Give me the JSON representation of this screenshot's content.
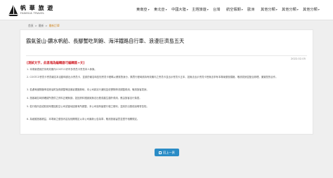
{
  "header": {
    "logo_zh": "帆 華 旅 遊",
    "logo_en": "FANHUA TRAVEL",
    "nav": [
      {
        "label": "東南亞",
        "dropdown": true
      },
      {
        "label": "東北亞",
        "dropdown": true
      },
      {
        "label": "中國大陸",
        "dropdown": true
      },
      {
        "label": "主題旅遊",
        "dropdown": true
      },
      {
        "label": "台灣",
        "dropdown": false
      },
      {
        "label": "航空假期",
        "dropdown": true
      },
      {
        "label": "歐洲",
        "dropdown": false
      },
      {
        "label": "其他分類",
        "dropdown": true
      },
      {
        "label": "其他分類",
        "dropdown": true
      },
      {
        "label": "其他分類",
        "dropdown": true
      }
    ]
  },
  "breadcrumb": {
    "home": "首頁",
    "section": "最新",
    "current": "最新訂單"
  },
  "article": {
    "title": "霸氣釜山-鑽水帆船、長腳蟹吃到飽、海洋鐵路自行車、浪漫巨濟島五天",
    "date": "2022.02.05",
    "notice": "[測試文字，此區塊為編輯器可編輯區+文]",
    "paragraphs": [
      "1. 本專案適用於持有效期內COSTCO好市多會員卡會員本人參與。",
      "2. COSTCO會員卡會員報名本活動時請出示會員卡，並請於報名時告知會員卡號碼以便核對身分，購買行程時請持有效期內之會員卡並出示會員卡正本，如無法出示會員卡恕無法享有本專案優惠價格，敬請見諒並配合辦理，謝謝您的合作。",
      "3. 若遇有國際匯率或燃油附加費調整等因素影響團費時，本公司將另行通知並依實際情況調整費用，敬請旅客見諒。",
      "4. 旅客報名時請確認所提供之資料正確無誤，如因資料錯誤致無法出發或產生額外費用，應由旅客自行負擔。",
      "5. 若行程內容或航班時間因航空公司或當地因素有所調整，本公司保有變更行程之權利，並將於出發前說明會告知。",
      "6. 為維護旅客權益，本專案之優惠內容及相關規定以本公司最新公告為準，敬請旅客留意並遵守相關規定。"
    ]
  },
  "back_button": {
    "label": "回上一頁"
  }
}
